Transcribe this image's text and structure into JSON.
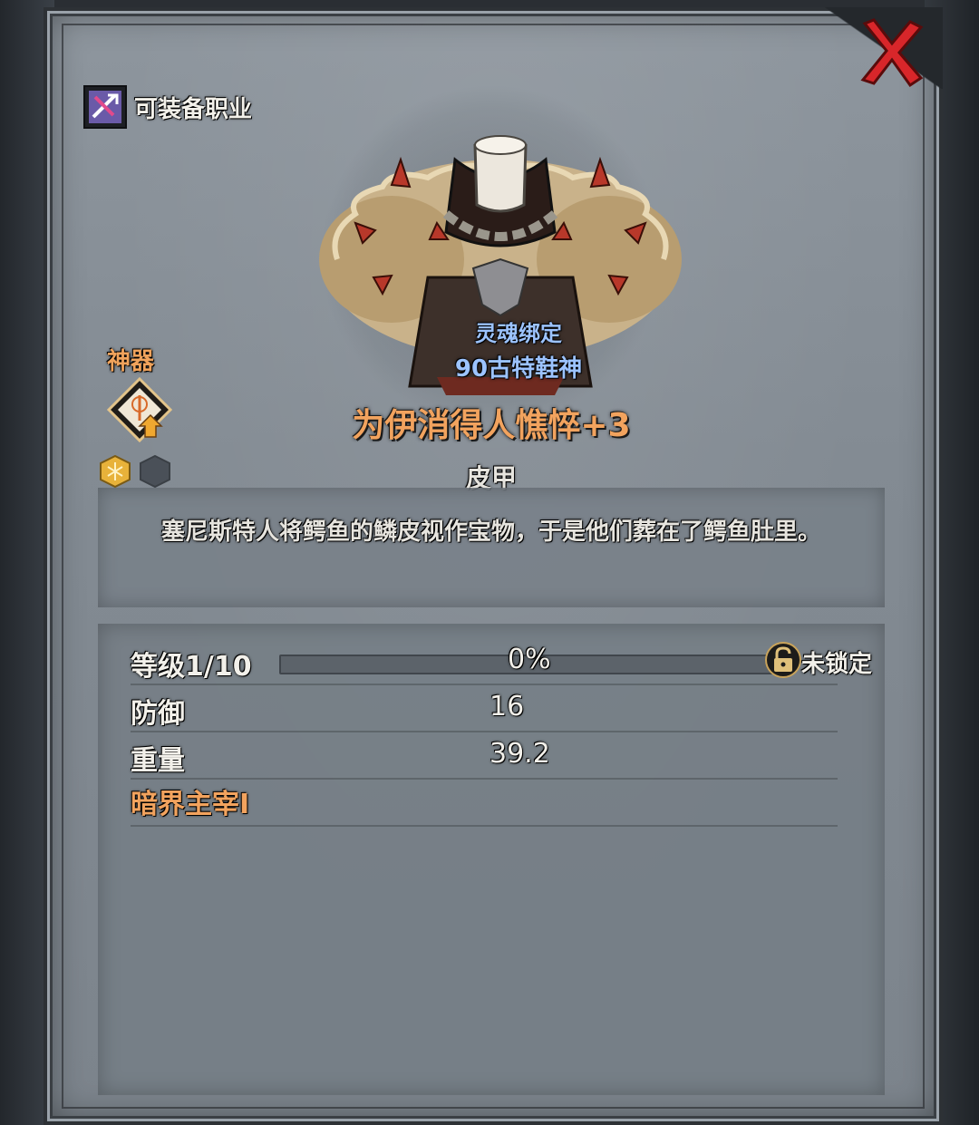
{
  "header": {
    "class_label": "可装备职业",
    "close_icon": "close-x-icon"
  },
  "artifact": {
    "label": "神器",
    "icon": "artifact-upgrade-icon",
    "gems": [
      "gold-gem-icon",
      "empty-gem-slot-icon"
    ]
  },
  "item": {
    "image": "fur-armor-image",
    "bind_type": "灵魂绑定",
    "god_source": "90古特鞋神",
    "name": "为伊消得人憔悴+3",
    "type": "皮甲",
    "description": "塞尼斯特人将鳄鱼的鳞皮视作宝物，于是他们葬在了鳄鱼肚里。"
  },
  "stats": {
    "level_label": "等级1/10",
    "progress_text": "0%",
    "progress_fraction": 0,
    "lock_icon": "padlock-icon",
    "lock_label": "未锁定",
    "rows": [
      {
        "name": "防御",
        "value": "16"
      },
      {
        "name": "重量",
        "value": "39.2"
      }
    ],
    "set_bonus": "暗界主宰I"
  },
  "colors": {
    "accent_orange": "#f2a35e",
    "blue_text": "#9cc3ff",
    "close_red": "#d8262a"
  }
}
